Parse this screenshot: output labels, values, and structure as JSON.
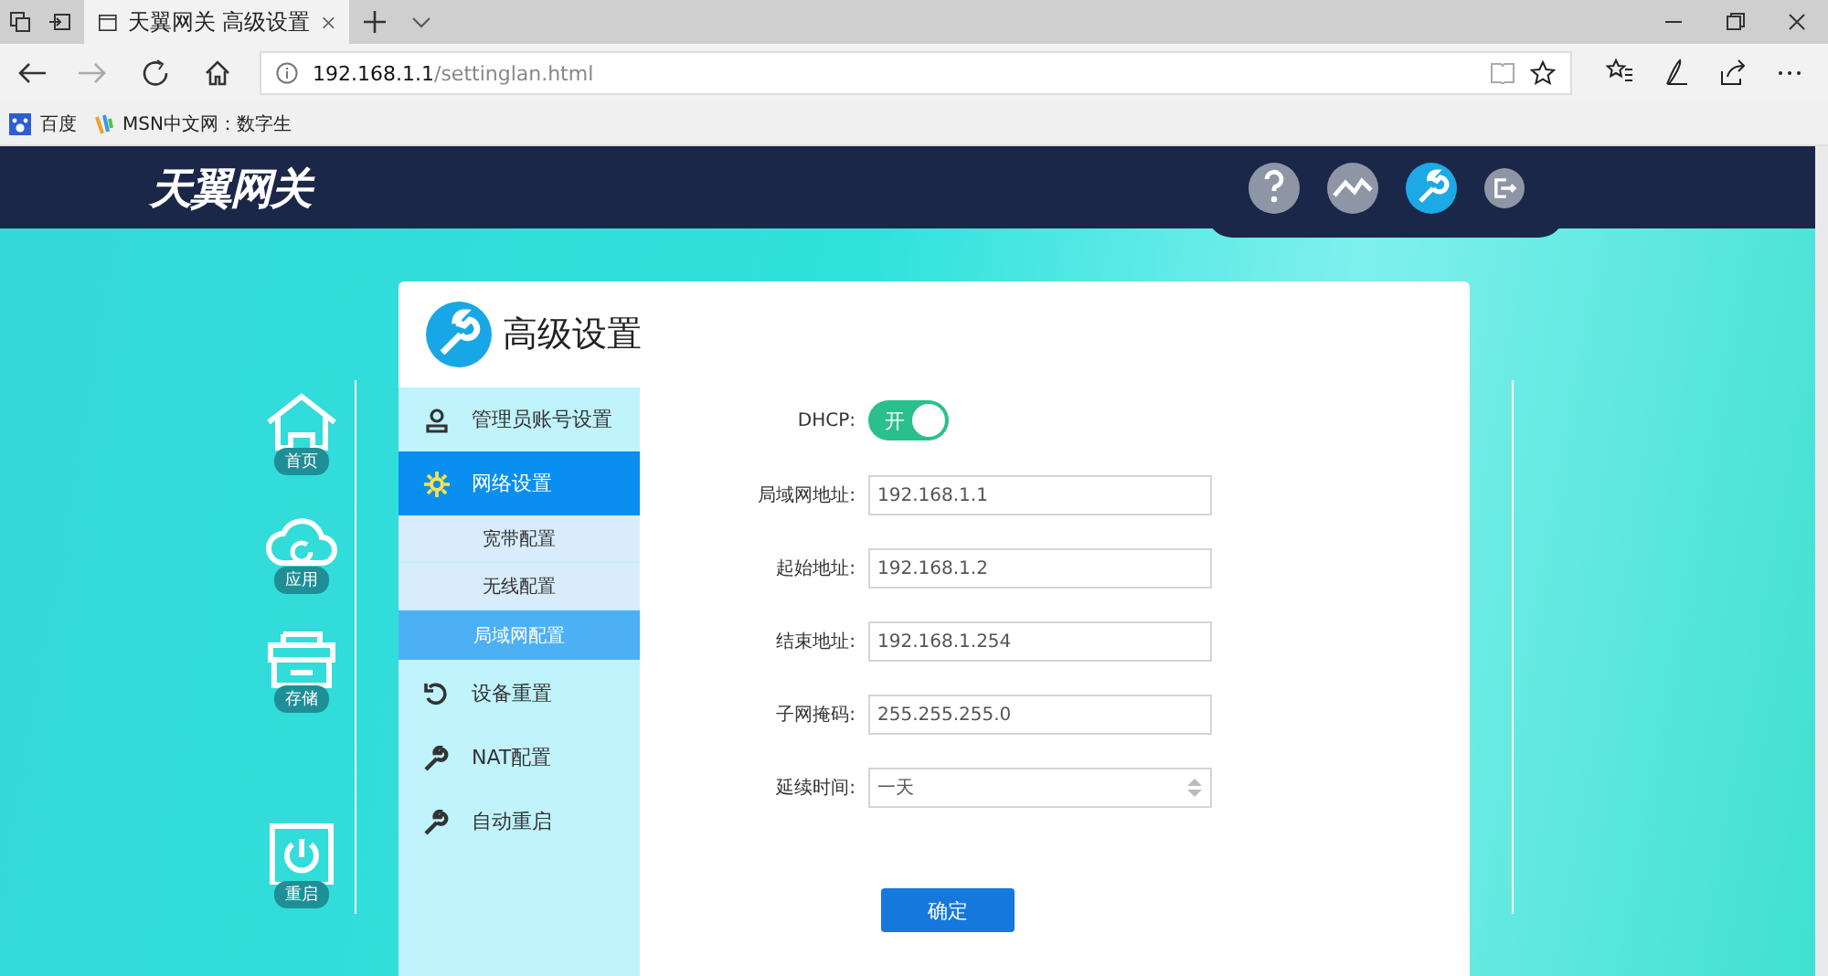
{
  "browser": {
    "tabs": [
      {
        "title": "天翼网关 高级设置",
        "selected": true
      }
    ],
    "address": {
      "host": "192.168.1.1",
      "path": "/settinglan.html"
    },
    "favorites": [
      {
        "label": "百度",
        "kind": "paw"
      },
      {
        "label": "MSN中文网：数字生",
        "kind": "msn"
      }
    ]
  },
  "app": {
    "logo": "天翼网关",
    "top_nav": [
      {
        "kind": "help",
        "selected": false
      },
      {
        "kind": "chart",
        "selected": false
      },
      {
        "kind": "wrench",
        "selected": true
      },
      {
        "kind": "logout",
        "selected": false
      }
    ],
    "left_nav": [
      {
        "kind": "home",
        "label": "首页"
      },
      {
        "kind": "cloud",
        "label": "应用"
      },
      {
        "kind": "storage",
        "label": "存储"
      },
      {
        "kind": "power",
        "label": "重启"
      }
    ]
  },
  "panel": {
    "title": "高级设置",
    "menu": [
      {
        "kind": "user",
        "label": "管理员账号设置",
        "selected": false
      },
      {
        "kind": "gear",
        "label": "网络设置",
        "selected": true,
        "children": [
          {
            "label": "宽带配置",
            "selected": false
          },
          {
            "label": "无线配置",
            "selected": false
          },
          {
            "label": "局域网配置",
            "selected": true
          }
        ]
      },
      {
        "kind": "reset",
        "label": "设备重置",
        "selected": false
      },
      {
        "kind": "wrench",
        "label": "NAT配置",
        "selected": false
      },
      {
        "kind": "wrench",
        "label": "自动重启",
        "selected": false
      }
    ],
    "form": {
      "dhcp": {
        "label": "DHCP:",
        "on": true,
        "text": "开"
      },
      "fields": [
        {
          "kind": "text",
          "label": "局域网地址:",
          "value": "192.168.1.1"
        },
        {
          "kind": "text",
          "label": "起始地址:",
          "value": "192.168.1.2"
        },
        {
          "kind": "text",
          "label": "结束地址:",
          "value": "192.168.1.254"
        },
        {
          "kind": "text",
          "label": "子网掩码:",
          "value": "255.255.255.0"
        },
        {
          "kind": "select",
          "label": "延续时间:",
          "value": "一天"
        }
      ],
      "submit": "确定"
    }
  }
}
